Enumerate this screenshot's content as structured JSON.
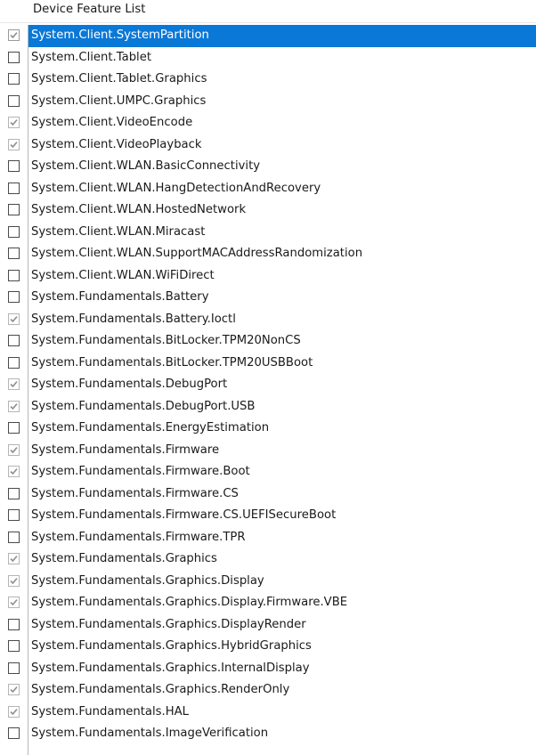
{
  "header": {
    "title": "Device Feature List"
  },
  "features": [
    {
      "label": "System.Client.SystemPartition",
      "checked": true,
      "selected": true
    },
    {
      "label": "System.Client.Tablet",
      "checked": false
    },
    {
      "label": "System.Client.Tablet.Graphics",
      "checked": false
    },
    {
      "label": "System.Client.UMPC.Graphics",
      "checked": false
    },
    {
      "label": "System.Client.VideoEncode",
      "checked": true
    },
    {
      "label": "System.Client.VideoPlayback",
      "checked": true
    },
    {
      "label": "System.Client.WLAN.BasicConnectivity",
      "checked": false
    },
    {
      "label": "System.Client.WLAN.HangDetectionAndRecovery",
      "checked": false
    },
    {
      "label": "System.Client.WLAN.HostedNetwork",
      "checked": false
    },
    {
      "label": "System.Client.WLAN.Miracast",
      "checked": false
    },
    {
      "label": "System.Client.WLAN.SupportMACAddressRandomization",
      "checked": false
    },
    {
      "label": "System.Client.WLAN.WiFiDirect",
      "checked": false
    },
    {
      "label": "System.Fundamentals.Battery",
      "checked": false
    },
    {
      "label": "System.Fundamentals.Battery.Ioctl",
      "checked": true
    },
    {
      "label": "System.Fundamentals.BitLocker.TPM20NonCS",
      "checked": false
    },
    {
      "label": "System.Fundamentals.BitLocker.TPM20USBBoot",
      "checked": false
    },
    {
      "label": "System.Fundamentals.DebugPort",
      "checked": true
    },
    {
      "label": "System.Fundamentals.DebugPort.USB",
      "checked": true
    },
    {
      "label": "System.Fundamentals.EnergyEstimation",
      "checked": false
    },
    {
      "label": "System.Fundamentals.Firmware",
      "checked": true
    },
    {
      "label": "System.Fundamentals.Firmware.Boot",
      "checked": true
    },
    {
      "label": "System.Fundamentals.Firmware.CS",
      "checked": false
    },
    {
      "label": "System.Fundamentals.Firmware.CS.UEFISecureBoot",
      "checked": false
    },
    {
      "label": "System.Fundamentals.Firmware.TPR",
      "checked": false
    },
    {
      "label": "System.Fundamentals.Graphics",
      "checked": true
    },
    {
      "label": "System.Fundamentals.Graphics.Display",
      "checked": true
    },
    {
      "label": "System.Fundamentals.Graphics.Display.Firmware.VBE",
      "checked": true
    },
    {
      "label": "System.Fundamentals.Graphics.DisplayRender",
      "checked": false
    },
    {
      "label": "System.Fundamentals.Graphics.HybridGraphics",
      "checked": false
    },
    {
      "label": "System.Fundamentals.Graphics.InternalDisplay",
      "checked": false
    },
    {
      "label": "System.Fundamentals.Graphics.RenderOnly",
      "checked": true
    },
    {
      "label": "System.Fundamentals.HAL",
      "checked": true
    },
    {
      "label": "System.Fundamentals.ImageVerification",
      "checked": false
    }
  ],
  "colors": {
    "selection": "#0a78d7",
    "check_mark": "#8c8c8c",
    "divider": "#b7b7b7"
  }
}
